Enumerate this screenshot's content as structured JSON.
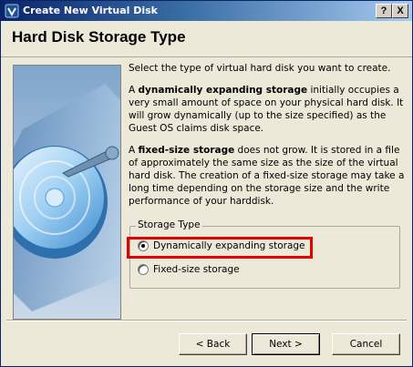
{
  "window": {
    "title": "Create New Virtual Disk",
    "help_label": "?",
    "close_label": "X"
  },
  "header": {
    "title": "Hard Disk Storage Type"
  },
  "content": {
    "intro": "Select the type of virtual hard disk you want to create.",
    "dynamic_term": "dynamically expanding storage",
    "dynamic_prefix": "A ",
    "dynamic_desc": " initially occupies a very small amount of space on your physical hard disk. It will grow dynamically (up to the size specified) as the Guest OS claims disk space.",
    "fixed_term": "fixed-size storage",
    "fixed_prefix": "A ",
    "fixed_desc": " does not grow. It is stored in a file of approximately the same size as the size of the virtual hard disk. The creation of a fixed-size storage may take a long time depending on the storage size and the write performance of your harddisk."
  },
  "storage_type": {
    "label": "Storage Type",
    "options": [
      {
        "label": "Dynamically expanding storage",
        "selected": true
      },
      {
        "label": "Fixed-size storage",
        "selected": false
      }
    ]
  },
  "buttons": {
    "back": "< Back",
    "next": "Next >",
    "cancel": "Cancel"
  },
  "colors": {
    "title_bar": "#0a246a",
    "highlight": "#e00000",
    "dialog_bg": "#ece9d8"
  },
  "icons": {
    "title": "virtualbox-icon",
    "illustration": "hard-disk-illustration"
  }
}
